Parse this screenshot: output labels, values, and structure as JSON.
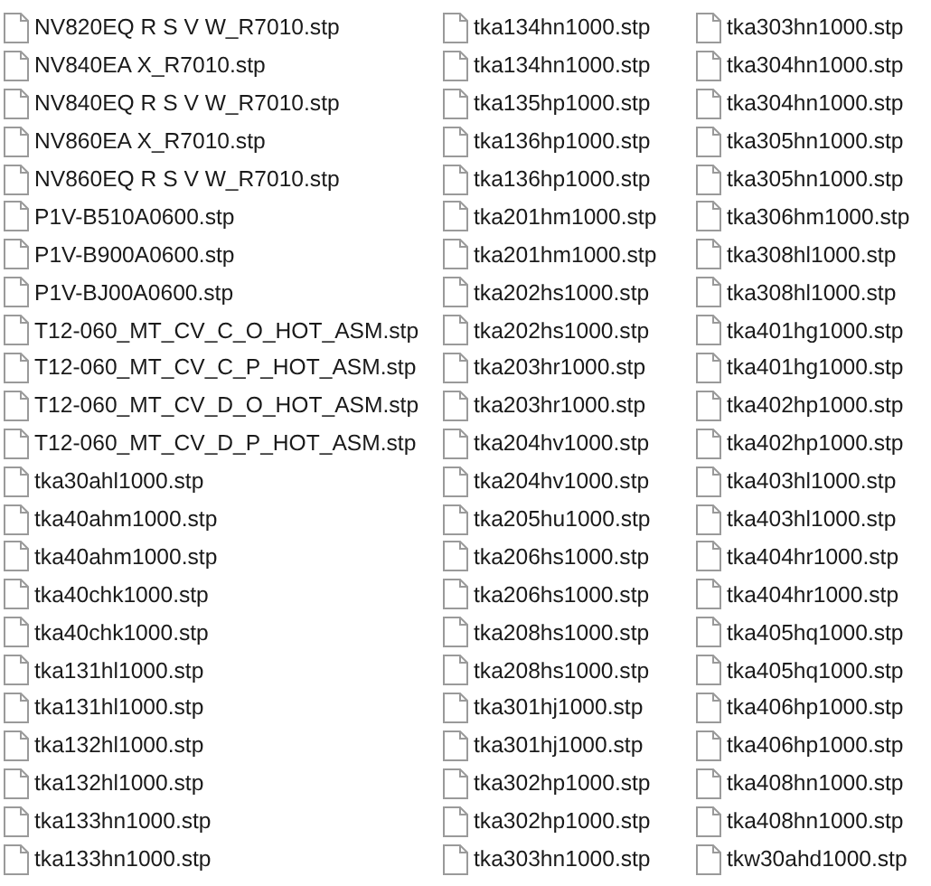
{
  "columns": [
    {
      "files": [
        "NV820EQ R S V W_R7010.stp",
        "NV840EA X_R7010.stp",
        "NV840EQ R S V W_R7010.stp",
        "NV860EA X_R7010.stp",
        "NV860EQ R S V W_R7010.stp",
        "P1V-B510A0600.stp",
        "P1V-B900A0600.stp",
        "P1V-BJ00A0600.stp",
        "T12-060_MT_CV_C_O_HOT_ASM.stp",
        "T12-060_MT_CV_C_P_HOT_ASM.stp",
        "T12-060_MT_CV_D_O_HOT_ASM.stp",
        "T12-060_MT_CV_D_P_HOT_ASM.stp",
        "tka30ahl1000.stp",
        "tka40ahm1000.stp",
        "tka40ahm1000.stp",
        "tka40chk1000.stp",
        "tka40chk1000.stp",
        "tka131hl1000.stp",
        "tka131hl1000.stp",
        "tka132hl1000.stp",
        "tka132hl1000.stp",
        "tka133hn1000.stp",
        "tka133hn1000.stp"
      ]
    },
    {
      "files": [
        "tka134hn1000.stp",
        "tka134hn1000.stp",
        "tka135hp1000.stp",
        "tka136hp1000.stp",
        "tka136hp1000.stp",
        "tka201hm1000.stp",
        "tka201hm1000.stp",
        "tka202hs1000.stp",
        "tka202hs1000.stp",
        "tka203hr1000.stp",
        "tka203hr1000.stp",
        "tka204hv1000.stp",
        "tka204hv1000.stp",
        "tka205hu1000.stp",
        "tka206hs1000.stp",
        "tka206hs1000.stp",
        "tka208hs1000.stp",
        "tka208hs1000.stp",
        "tka301hj1000.stp",
        "tka301hj1000.stp",
        "tka302hp1000.stp",
        "tka302hp1000.stp",
        "tka303hn1000.stp"
      ]
    },
    {
      "files": [
        "tka303hn1000.stp",
        "tka304hn1000.stp",
        "tka304hn1000.stp",
        "tka305hn1000.stp",
        "tka305hn1000.stp",
        "tka306hm1000.stp",
        "tka308hl1000.stp",
        "tka308hl1000.stp",
        "tka401hg1000.stp",
        "tka401hg1000.stp",
        "tka402hp1000.stp",
        "tka402hp1000.stp",
        "tka403hl1000.stp",
        "tka403hl1000.stp",
        "tka404hr1000.stp",
        "tka404hr1000.stp",
        "tka405hq1000.stp",
        "tka405hq1000.stp",
        "tka406hp1000.stp",
        "tka406hp1000.stp",
        "tka408hn1000.stp",
        "tka408hn1000.stp",
        "tkw30ahd1000.stp"
      ]
    }
  ]
}
